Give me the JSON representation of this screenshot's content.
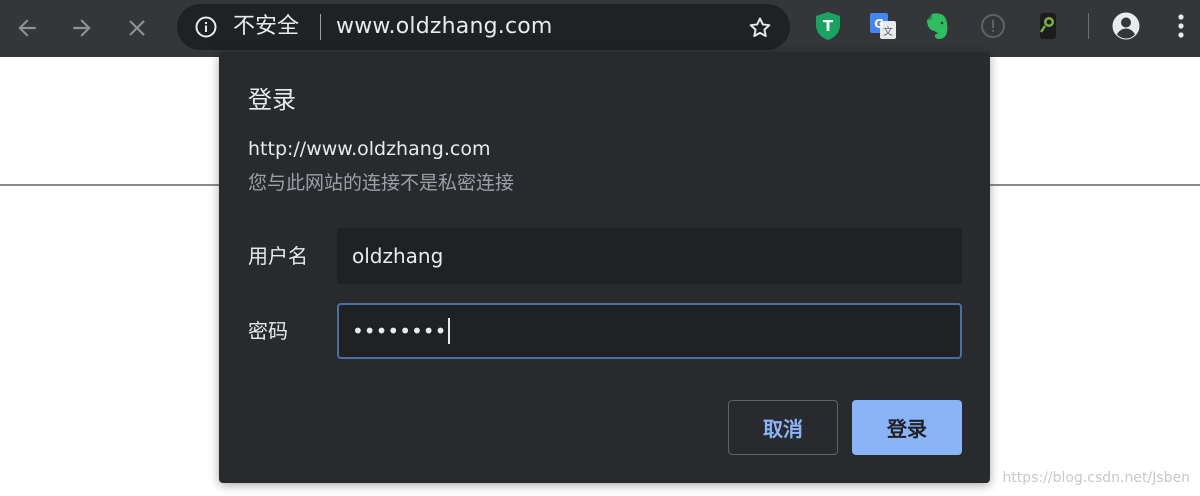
{
  "browser": {
    "security_label": "不安全",
    "url": "www.oldzhang.com",
    "extensions": [
      {
        "name": "tampermonkey",
        "glyph": "T",
        "color": "#1aa260"
      },
      {
        "name": "google-translate",
        "glyph": "G",
        "color": "#4285f4"
      },
      {
        "name": "evernote",
        "color": "#2dbe60"
      },
      {
        "name": "disabled-extension",
        "glyph": "!",
        "color": "#5f6368"
      },
      {
        "name": "search-extension",
        "color": "#7cb342"
      }
    ],
    "colors": {
      "toolbar": "#35363a",
      "omnibox": "#202124"
    }
  },
  "dialog": {
    "title": "登录",
    "origin": "http://www.oldzhang.com",
    "warning": "您与此网站的连接不是私密连接",
    "username_label": "用户名",
    "username_value": "oldzhang",
    "password_label": "密码",
    "password_value": "••••••••",
    "cancel_label": "取消",
    "login_label": "登录",
    "colors": {
      "background": "#292a2d",
      "accent": "#8ab4f8"
    }
  },
  "page": {
    "watermark": "https://blog.csdn.net/Jsben"
  }
}
